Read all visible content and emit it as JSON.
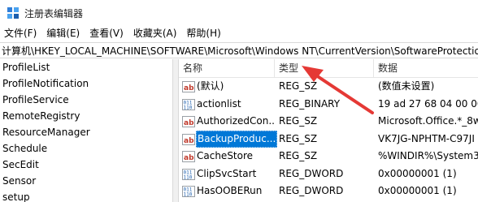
{
  "window": {
    "title": "注册表编辑器"
  },
  "menu": [
    {
      "label": "文件(F)"
    },
    {
      "label": "编辑(E)"
    },
    {
      "label": "查看(V)"
    },
    {
      "label": "收藏夹(A)"
    },
    {
      "label": "帮助(H)"
    }
  ],
  "address": {
    "path": "计算机\\HKEY_LOCAL_MACHINE\\SOFTWARE\\Microsoft\\Windows NT\\CurrentVersion\\SoftwareProtectio"
  },
  "tree": {
    "items": [
      {
        "label": "ProfileList"
      },
      {
        "label": "ProfileNotification"
      },
      {
        "label": "ProfileService"
      },
      {
        "label": "RemoteRegistry"
      },
      {
        "label": "ResourceManager"
      },
      {
        "label": "Schedule"
      },
      {
        "label": "SecEdit"
      },
      {
        "label": "Sensor"
      },
      {
        "label": "setup"
      }
    ]
  },
  "list": {
    "columns": {
      "name": "名称",
      "type": "类型",
      "data": "数据"
    },
    "rows": [
      {
        "icon": "string-value-icon",
        "name": "(默认)",
        "type": "REG_SZ",
        "data": "(数值未设置)"
      },
      {
        "icon": "binary-value-icon",
        "name": "actionlist",
        "type": "REG_BINARY",
        "data": "19 ad 27 68 04 00 00"
      },
      {
        "icon": "string-value-icon",
        "name": "AuthorizedCon...",
        "type": "REG_SZ",
        "data": "Microsoft.Office.*_8w"
      },
      {
        "icon": "string-value-icon",
        "name": "BackupProduc...",
        "type": "REG_SZ",
        "data": "VK7JG-NPHTM-C97JI",
        "selected": true
      },
      {
        "icon": "string-value-icon",
        "name": "CacheStore",
        "type": "REG_SZ",
        "data": "%WINDIR%\\System3"
      },
      {
        "icon": "binary-value-icon",
        "name": "ClipSvcStart",
        "type": "REG_DWORD",
        "data": "0x00000001 (1)"
      },
      {
        "icon": "binary-value-icon",
        "name": "HasOOBERun",
        "type": "REG_DWORD",
        "data": "0x00000001 (1)"
      }
    ]
  },
  "colors": {
    "selection": "#0078d7",
    "annotation_arrow": "#e53935"
  }
}
